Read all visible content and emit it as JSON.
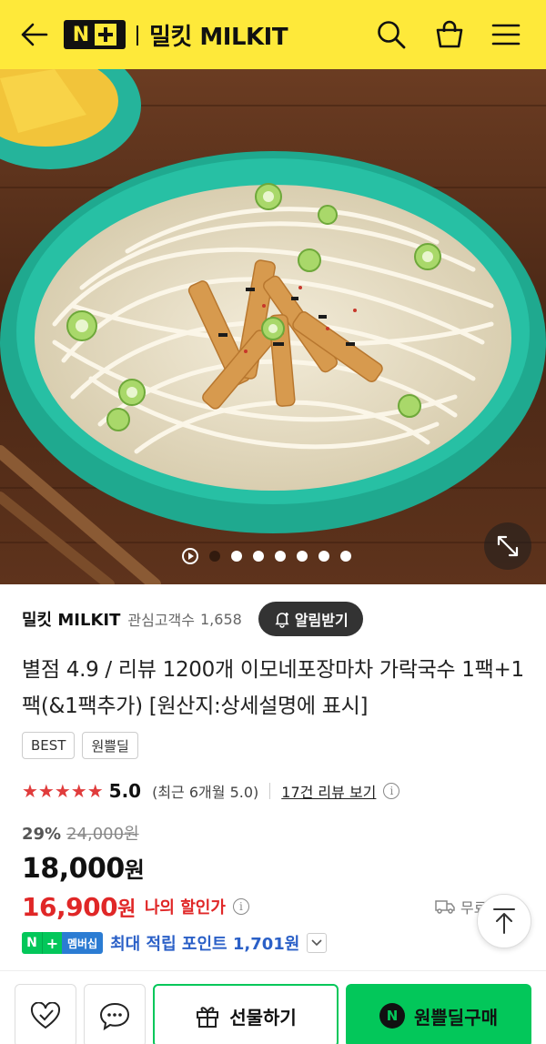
{
  "header": {
    "logo_n": "N",
    "store_title": "밀킷 MILKIT"
  },
  "hero": {
    "image_subject": "가락국수 bowl with fish cake and scallions",
    "total_slides": 7,
    "active_slide": 1
  },
  "seller": {
    "name": "밀킷 MILKIT",
    "follower_label": "관심고객수",
    "follower_count": "1,658",
    "alert_button": "알림받기"
  },
  "product": {
    "title": "별점 4.9 / 리뷰 1200개 이모네포장마차 가락국수 1팩+1팩(&1팩추가) [원산지:상세설명에 표시]",
    "badges": [
      "BEST",
      "원쁠딜"
    ]
  },
  "rating": {
    "stars": "★★★★★",
    "value": "5.0",
    "recent": "(최근 6개월 5.0)",
    "review_link": "17건 리뷰 보기"
  },
  "price": {
    "discount_rate": "29%",
    "original": "24,000원",
    "sale_amount": "18,000",
    "sale_unit": "원",
    "my_amount": "16,900",
    "my_unit": "원",
    "my_label": "나의 할인가",
    "delivery_text": "무료"
  },
  "membership": {
    "badge_n": "N",
    "badge_plus": "+",
    "badge_label": "멤버십",
    "text": "최대 적립 포인트 1,701원"
  },
  "bottom": {
    "gift_label": "선물하기",
    "buy_label": "원쁠딜구매",
    "npay_letter": "N"
  },
  "colors": {
    "header_bg": "#fee93a",
    "naver_green": "#03c75a",
    "price_red": "#e02727",
    "membership_blue": "#2b60c7"
  }
}
